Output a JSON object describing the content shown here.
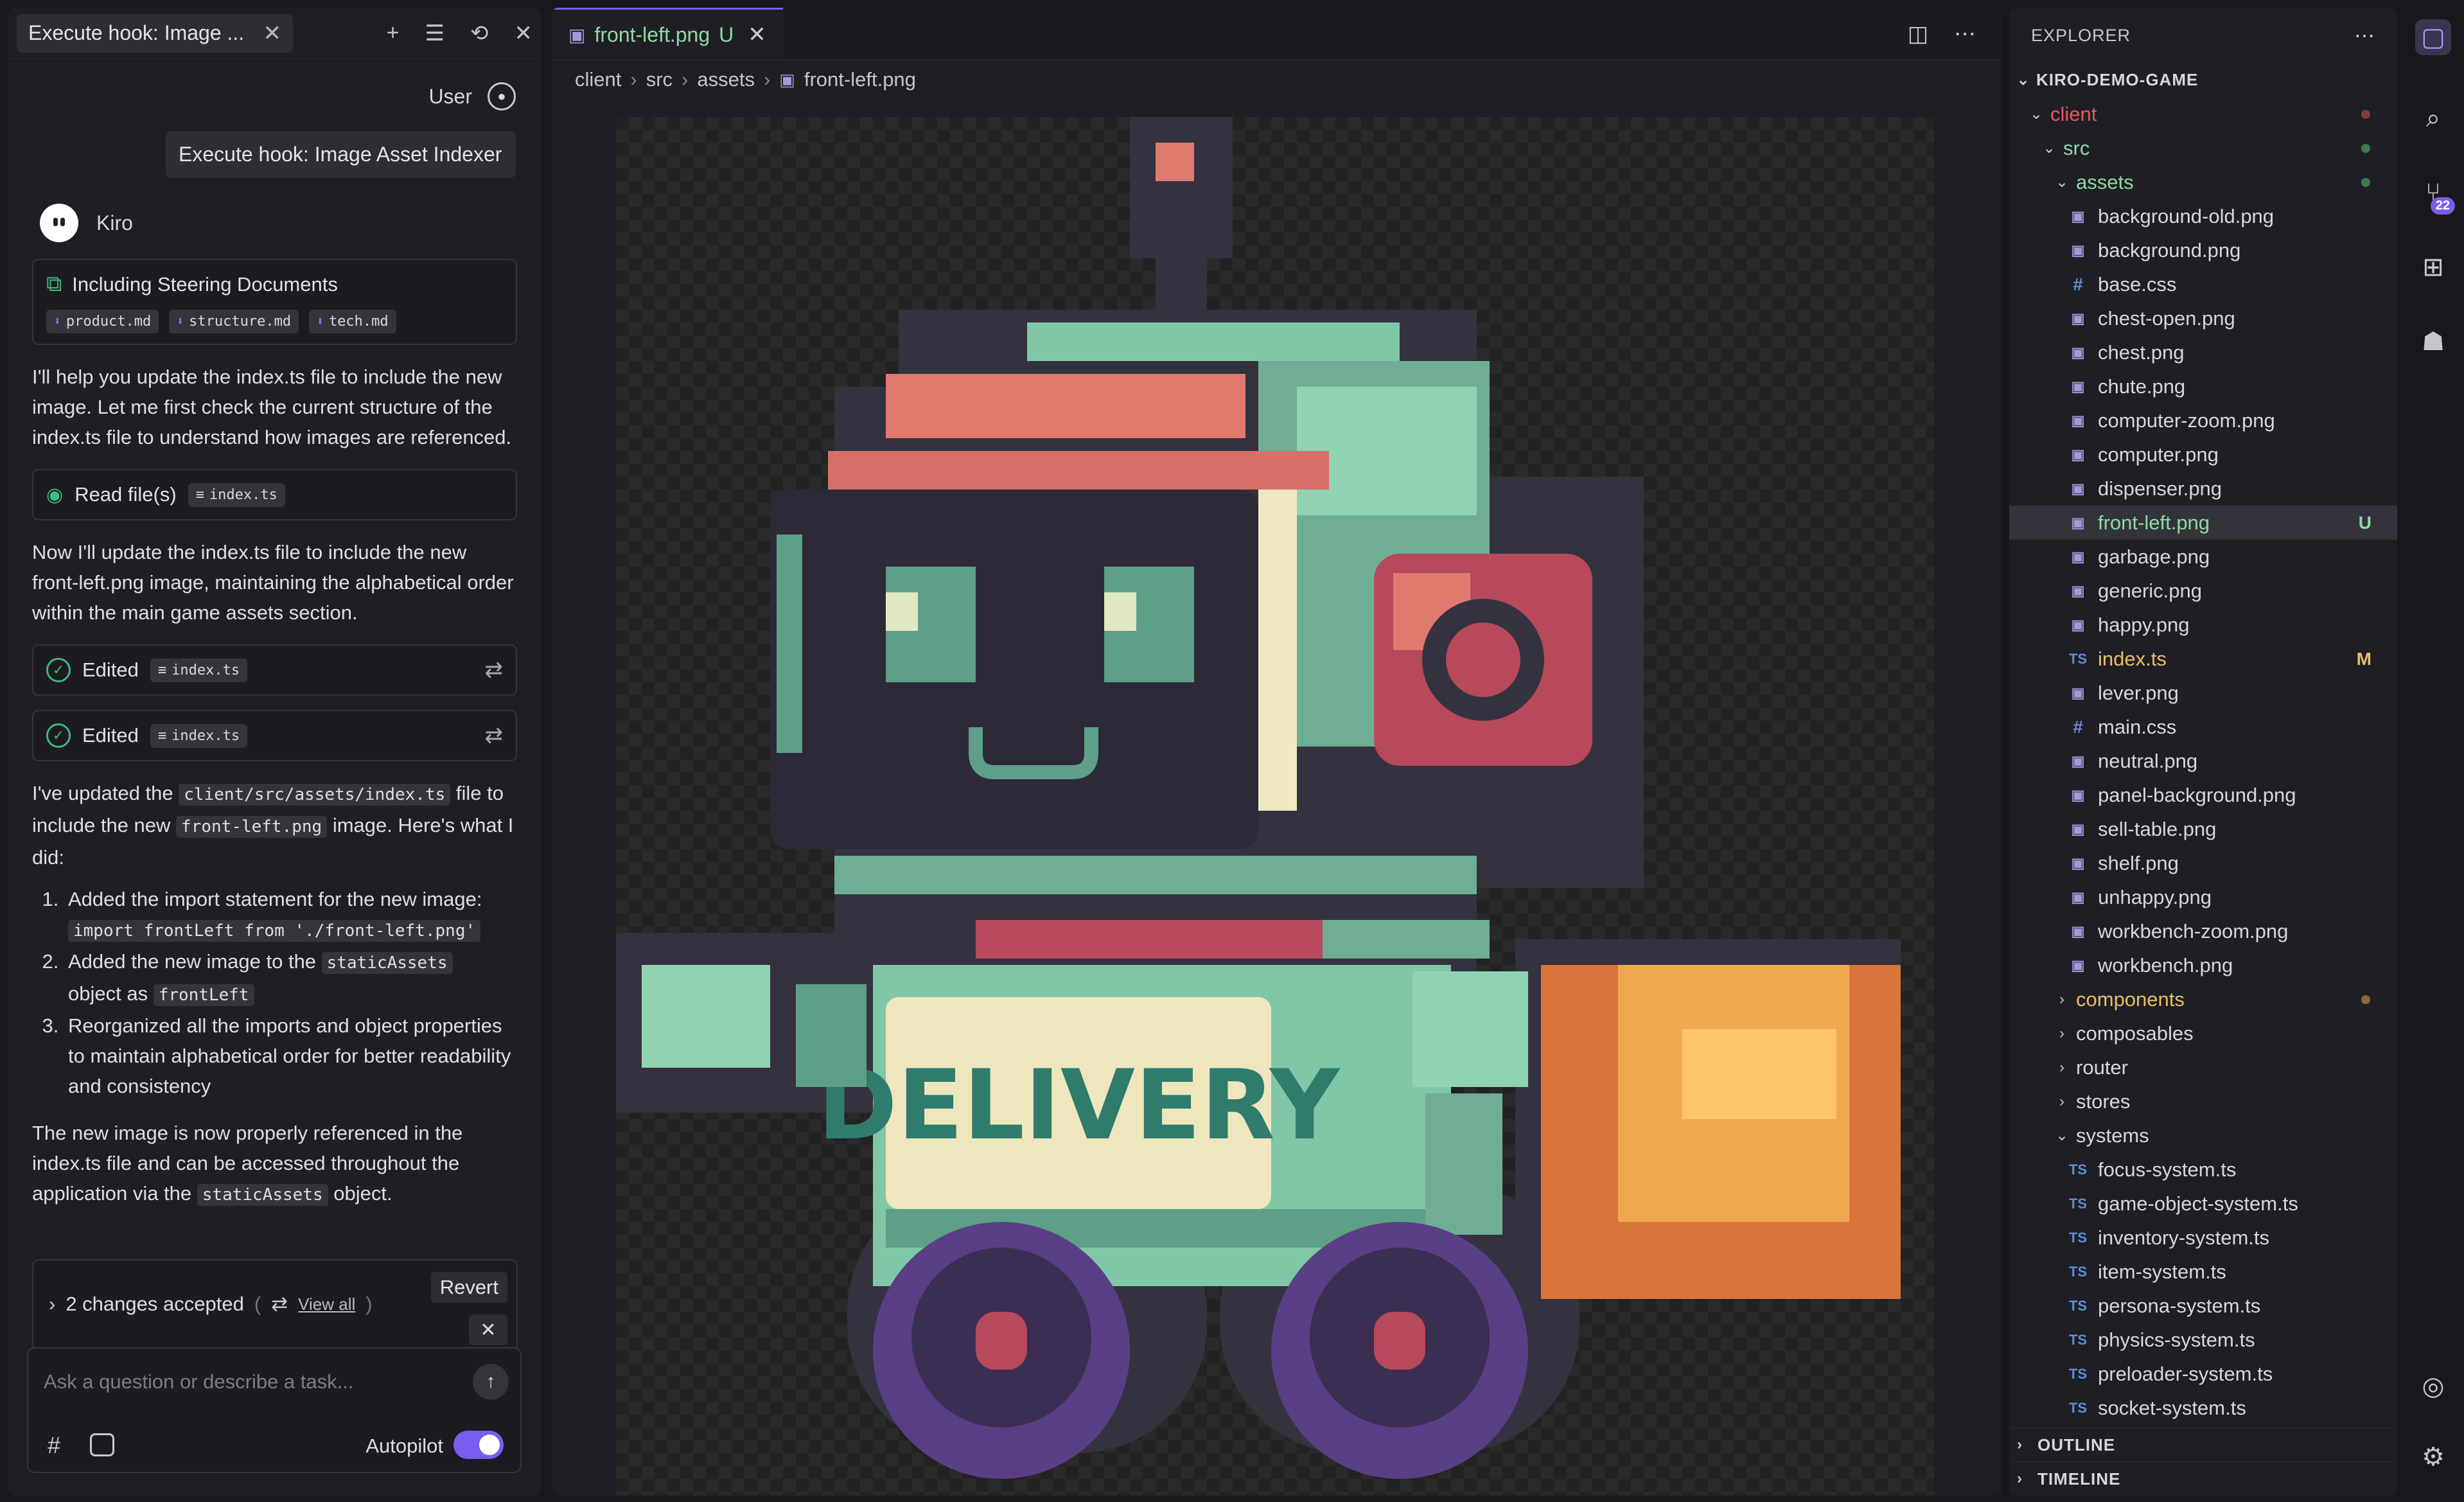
{
  "chat": {
    "tab_title": "Execute hook: Image ...",
    "user_label": "User",
    "user_message": "Execute hook: Image Asset Indexer",
    "agent_name": "Kiro",
    "steering": {
      "title": "Including Steering Documents",
      "docs": [
        "product.md",
        "structure.md",
        "tech.md"
      ]
    },
    "para1": "I'll help you update the index.ts file to include the new image. Let me first check the current structure of the index.ts file to understand how images are referenced.",
    "read_files": {
      "label": "Read file(s)",
      "file": "index.ts"
    },
    "para2": "Now I'll update the index.ts file to include the new front-left.png image, maintaining the alphabetical order within the main game assets section.",
    "edits": [
      {
        "label": "Edited",
        "file": "index.ts"
      },
      {
        "label": "Edited",
        "file": "index.ts"
      }
    ],
    "summary": {
      "pre": "I've updated the ",
      "path": "client/src/assets/index.ts",
      "mid": " file to include the new ",
      "img": "front-left.png",
      "post": " image. Here's what I did:"
    },
    "steps": {
      "s1_text": "Added the import statement for the new image:",
      "s1_code": "import frontLeft from './front-left.png'",
      "s2_pre": "Added the new image to the ",
      "s2_code1": "staticAssets",
      "s2_mid": " object as ",
      "s2_code2": "frontLeft",
      "s3_text": "Reorganized all the imports and object properties to maintain alphabetical order for better readability and consistency"
    },
    "final": {
      "pre": "The new image is now properly referenced in the index.ts file and can be accessed throughout the application via the ",
      "code": "staticAssets",
      "post": " object."
    },
    "changes": {
      "label": "2 changes accepted",
      "paren_open": "(",
      "view_all": "View all",
      "paren_close": ")",
      "revert": "Revert"
    },
    "input": {
      "placeholder": "Ask a question or describe a task...",
      "autopilot": "Autopilot",
      "autopilot_on": true
    }
  },
  "editor": {
    "tab": {
      "name": "front-left.png",
      "status": "U"
    },
    "breadcrumb": [
      "client",
      "src",
      "assets",
      "front-left.png"
    ],
    "image_text": "DELIVERY"
  },
  "explorer": {
    "title": "EXPLORER",
    "root": "KIRO-DEMO-GAME",
    "folders": {
      "client": "client",
      "src": "src",
      "assets": "assets"
    },
    "assets": [
      {
        "name": "background-old.png",
        "type": "png"
      },
      {
        "name": "background.png",
        "type": "png"
      },
      {
        "name": "base.css",
        "type": "css"
      },
      {
        "name": "chest-open.png",
        "type": "png"
      },
      {
        "name": "chest.png",
        "type": "png"
      },
      {
        "name": "chute.png",
        "type": "png"
      },
      {
        "name": "computer-zoom.png",
        "type": "png"
      },
      {
        "name": "computer.png",
        "type": "png"
      },
      {
        "name": "dispenser.png",
        "type": "png"
      },
      {
        "name": "front-left.png",
        "type": "png",
        "status": "U",
        "selected": true
      },
      {
        "name": "garbage.png",
        "type": "png"
      },
      {
        "name": "generic.png",
        "type": "png"
      },
      {
        "name": "happy.png",
        "type": "png"
      },
      {
        "name": "index.ts",
        "type": "ts",
        "status": "M"
      },
      {
        "name": "lever.png",
        "type": "png"
      },
      {
        "name": "main.css",
        "type": "css"
      },
      {
        "name": "neutral.png",
        "type": "png"
      },
      {
        "name": "panel-background.png",
        "type": "png"
      },
      {
        "name": "sell-table.png",
        "type": "png"
      },
      {
        "name": "shelf.png",
        "type": "png"
      },
      {
        "name": "unhappy.png",
        "type": "png"
      },
      {
        "name": "workbench-zoom.png",
        "type": "png"
      },
      {
        "name": "workbench.png",
        "type": "png"
      }
    ],
    "src_folders": [
      "components",
      "composables",
      "router",
      "stores",
      "systems"
    ],
    "systems": [
      "focus-system.ts",
      "game-object-system.ts",
      "inventory-system.ts",
      "item-system.ts",
      "persona-system.ts",
      "physics-system.ts",
      "preloader-system.ts",
      "socket-system.ts"
    ],
    "outline": "OUTLINE",
    "timeline": "TIMELINE"
  },
  "activity": {
    "source_control_badge": "22"
  },
  "colors": {
    "accent": "#7b5cf0",
    "untracked": "#8fdba3",
    "modified": "#e8c06a",
    "folder_modified": "#e85a5a",
    "success": "#3fb87f"
  }
}
